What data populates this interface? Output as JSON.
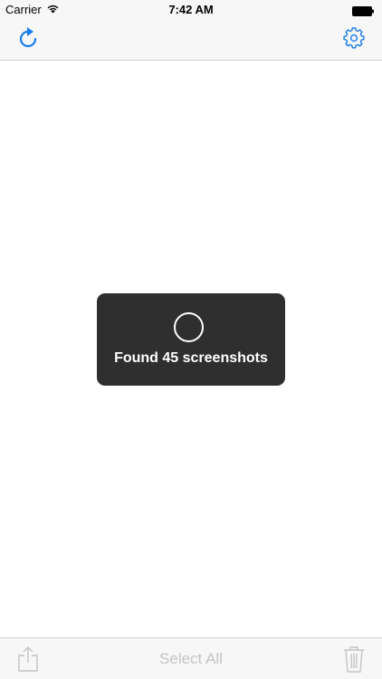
{
  "status_bar": {
    "carrier": "Carrier",
    "time": "7:42 AM",
    "wifi_icon": "wifi-icon",
    "battery_icon": "battery-icon"
  },
  "nav_bar": {
    "left_icon": "refresh-icon",
    "right_icon": "gear-icon",
    "accent_color": "#1a7cf0"
  },
  "hud": {
    "message": "Found 45 screenshots",
    "spinner_icon": "spinner-icon"
  },
  "toolbar": {
    "share_icon": "share-icon",
    "select_all_label": "Select All",
    "trash_icon": "trash-icon",
    "disabled_color": "#c4c4c8"
  }
}
